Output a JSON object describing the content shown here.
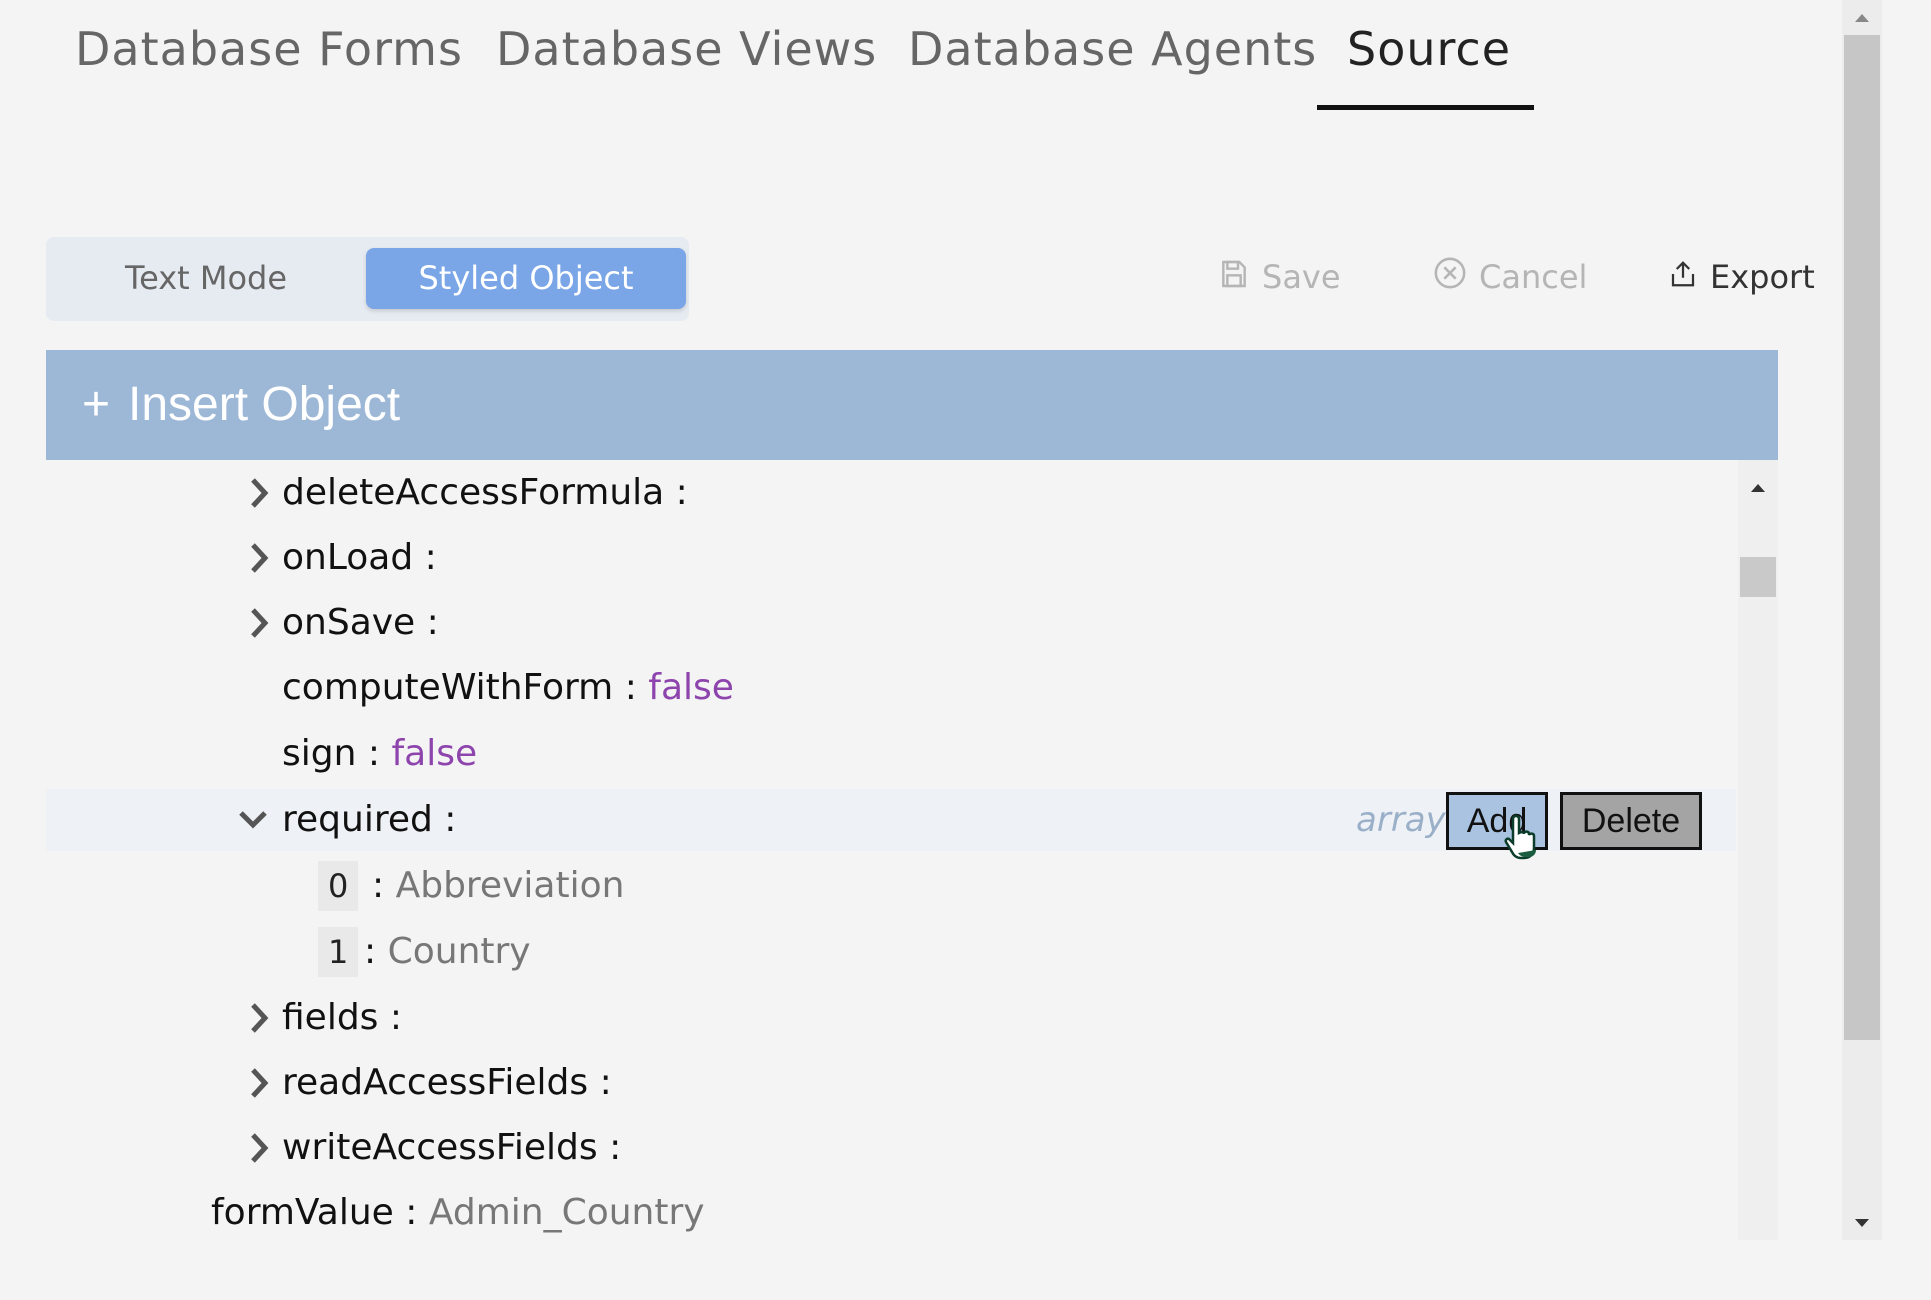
{
  "tabs": [
    {
      "label": "Database Forms"
    },
    {
      "label": "Database Views"
    },
    {
      "label": "Database Agents"
    },
    {
      "label": "Source",
      "active": true
    }
  ],
  "mode_switch": {
    "text_mode": "Text Mode",
    "styled_object": "Styled Object",
    "selected": "Styled Object"
  },
  "actions": {
    "save": "Save",
    "cancel": "Cancel",
    "export": "Export"
  },
  "insert_bar": {
    "plus": "+",
    "label": "Insert Object"
  },
  "tree": {
    "rows": [
      {
        "key": "deleteAccessFormula",
        "sep": ":"
      },
      {
        "key": "onLoad",
        "sep": ":"
      },
      {
        "key": "onSave",
        "sep": ":"
      },
      {
        "key": "computeWithForm",
        "sep": ":",
        "value": "false"
      },
      {
        "key": "sign",
        "sep": ":",
        "value": "false"
      },
      {
        "key": "required",
        "sep": ":",
        "type_hint": "array",
        "add_label": "Add",
        "delete_label": "Delete"
      },
      {
        "index": "0",
        "sep": ":",
        "value": "Abbreviation"
      },
      {
        "index": "1",
        "sep": ":",
        "value": "Country"
      },
      {
        "key": "fields",
        "sep": ":"
      },
      {
        "key": "readAccessFields",
        "sep": ":"
      },
      {
        "key": "writeAccessFields",
        "sep": ":"
      },
      {
        "key": "formValue",
        "sep": ":",
        "value": "Admin_Country"
      }
    ]
  },
  "colors": {
    "accent": "#7aa5e6",
    "insert_bar": "#9db8d6",
    "bool_value": "#8e44ad",
    "string_value": "#777777",
    "type_hint": "#9ab0c8"
  },
  "icons": {
    "save": "save-icon",
    "cancel": "cancel-circle-icon",
    "export": "export-icon",
    "collapsed": "chevron-right-icon",
    "expanded": "chevron-down-icon",
    "pointer": "hand-pointer-icon"
  }
}
